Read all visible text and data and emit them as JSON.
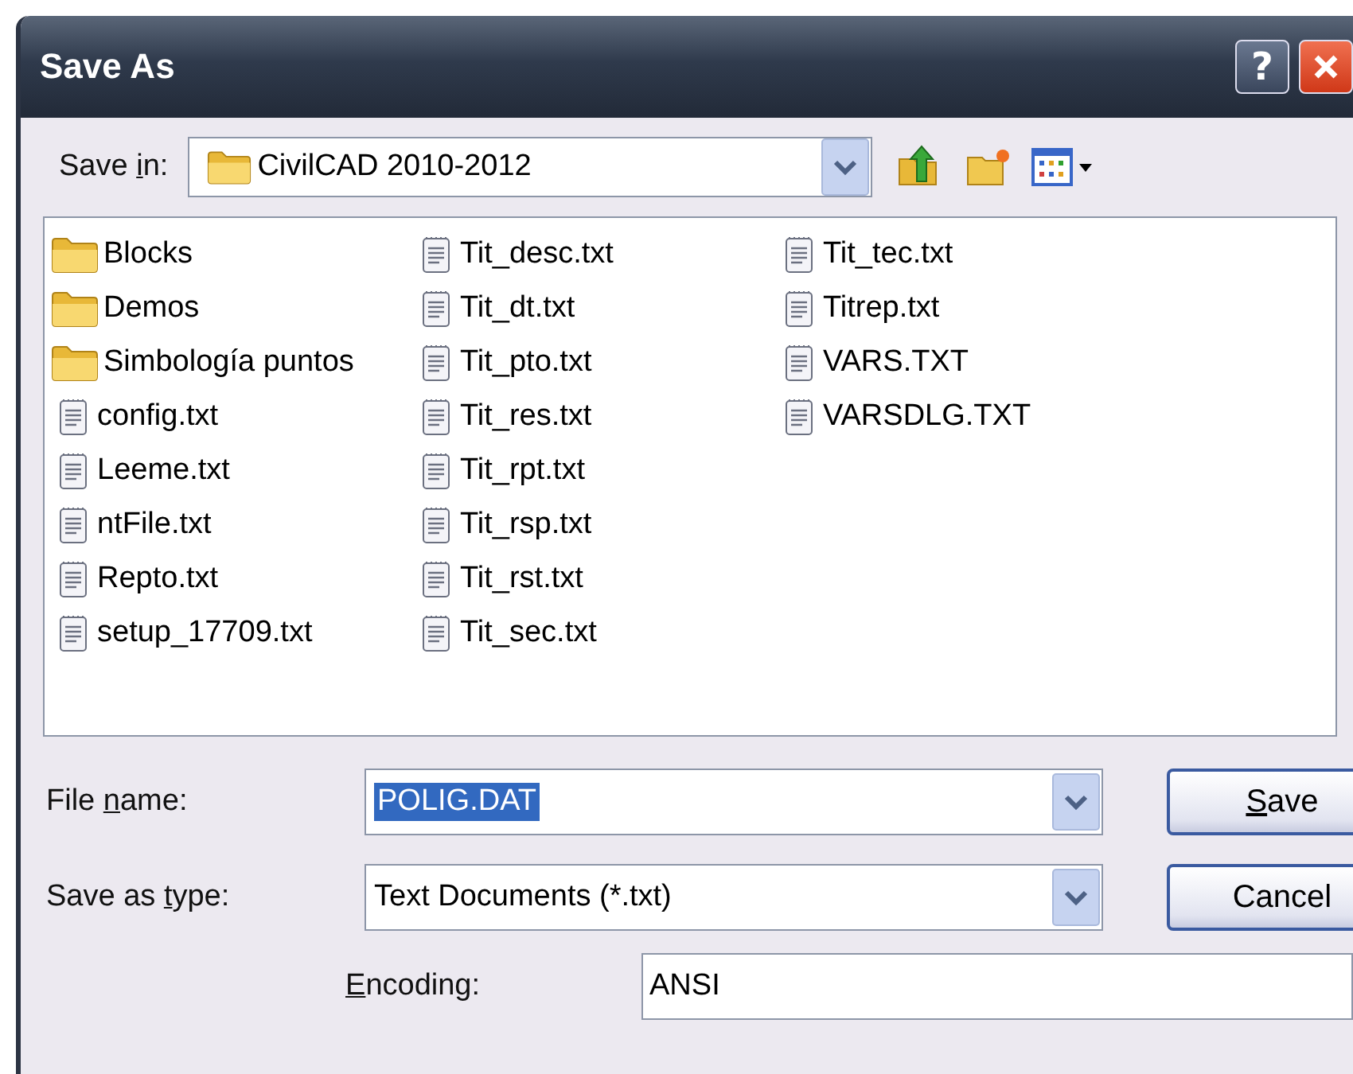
{
  "window": {
    "title": "Save As",
    "help_button": "?"
  },
  "save_in": {
    "label": {
      "before": "Save ",
      "key": "i",
      "after": "n:"
    },
    "value": "CivilCAD 2010-2012"
  },
  "files": [
    {
      "name": "Blocks",
      "kind": "folder"
    },
    {
      "name": "Demos",
      "kind": "folder"
    },
    {
      "name": "Simbología puntos",
      "kind": "folder"
    },
    {
      "name": "config.txt",
      "kind": "file"
    },
    {
      "name": "Leeme.txt",
      "kind": "file"
    },
    {
      "name": "ntFile.txt",
      "kind": "file"
    },
    {
      "name": "Repto.txt",
      "kind": "file"
    },
    {
      "name": "setup_17709.txt",
      "kind": "file"
    },
    {
      "name": "Tit_desc.txt",
      "kind": "file"
    },
    {
      "name": "Tit_dt.txt",
      "kind": "file"
    },
    {
      "name": "Tit_pto.txt",
      "kind": "file"
    },
    {
      "name": "Tit_res.txt",
      "kind": "file"
    },
    {
      "name": "Tit_rpt.txt",
      "kind": "file"
    },
    {
      "name": "Tit_rsp.txt",
      "kind": "file"
    },
    {
      "name": "Tit_rst.txt",
      "kind": "file"
    },
    {
      "name": "Tit_sec.txt",
      "kind": "file"
    },
    {
      "name": "Tit_tec.txt",
      "kind": "file"
    },
    {
      "name": "Titrep.txt",
      "kind": "file"
    },
    {
      "name": "VARS.TXT",
      "kind": "file"
    },
    {
      "name": "VARSDLG.TXT",
      "kind": "file"
    }
  ],
  "file_name": {
    "label": {
      "before": "File ",
      "key": "n",
      "after": "ame:"
    },
    "value": "POLIG.DAT",
    "selected": true
  },
  "save_as_type": {
    "label": {
      "before": "Save as ",
      "key": "t",
      "after": "ype:"
    },
    "value": "Text Documents (*.txt)"
  },
  "encoding": {
    "label": {
      "key": "E",
      "after": "ncoding:"
    },
    "value": "ANSI"
  },
  "buttons": [
    {
      "key": "S",
      "after": "ave"
    },
    {
      "before": "Cancel"
    }
  ]
}
